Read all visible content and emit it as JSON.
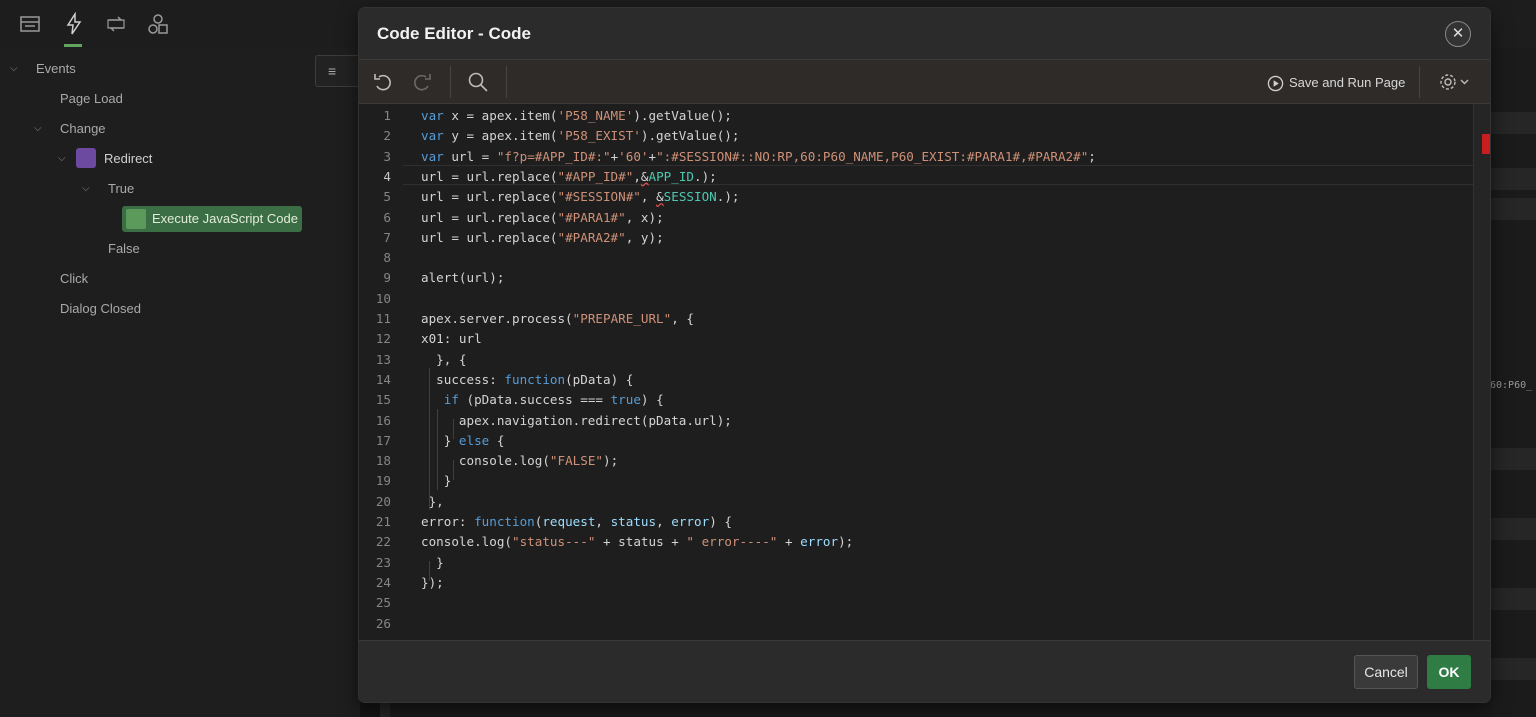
{
  "background": {
    "tree": {
      "events": "Events",
      "page_load": "Page Load",
      "change": "Change",
      "redirect": "Redirect",
      "true_label": "True",
      "execute_js": "Execute JavaScript Code",
      "false_label": "False",
      "click": "Click",
      "dialog_closed": "Dialog Closed"
    },
    "menu_icon": "≡",
    "right_snippet": "60:P60_"
  },
  "dialog": {
    "title": "Code Editor - Code",
    "close_icon": "✕",
    "toolbar": {
      "undo_icon": "undo-icon",
      "redo_icon": "redo-icon",
      "search_icon": "search-icon",
      "save_run_label": "Save and Run Page",
      "settings_icon": "gear-icon"
    },
    "code_lines": [
      "var x = apex.item('P58_NAME').getValue();",
      "var y = apex.item('P58_EXIST').getValue();",
      "var url = \"f?p=#APP_ID#:\"+'60'+\":#SESSION#::NO:RP,60:P60_NAME,P60_EXIST:#PARA1#,#PARA2#\";",
      "url = url.replace(\"#APP_ID#\",&APP_ID.);",
      "url = url.replace(\"#SESSION#\", &SESSION.);",
      "url = url.replace(\"#PARA1#\", x);",
      "url = url.replace(\"#PARA2#\", y);",
      "",
      "alert(url);",
      "",
      "apex.server.process(\"PREPARE_URL\", {",
      "x01: url",
      "  }, {",
      "  success: function(pData) {",
      "   if (pData.success === true) {",
      "     apex.navigation.redirect(pData.url);",
      "   } else {",
      "     console.log(\"FALSE\");",
      "   }",
      " },",
      "error: function(request, status, error) {",
      "console.log(\"status---\" + status + \" error----\" + error);",
      "  }",
      "});",
      "",
      ""
    ],
    "active_line": 4,
    "footer": {
      "cancel_label": "Cancel",
      "ok_label": "OK"
    }
  },
  "colors": {
    "keyword": "#569cd6",
    "string": "#ce9178",
    "ok_button": "#2f7d45",
    "execute_pill": "#3b6e44"
  }
}
